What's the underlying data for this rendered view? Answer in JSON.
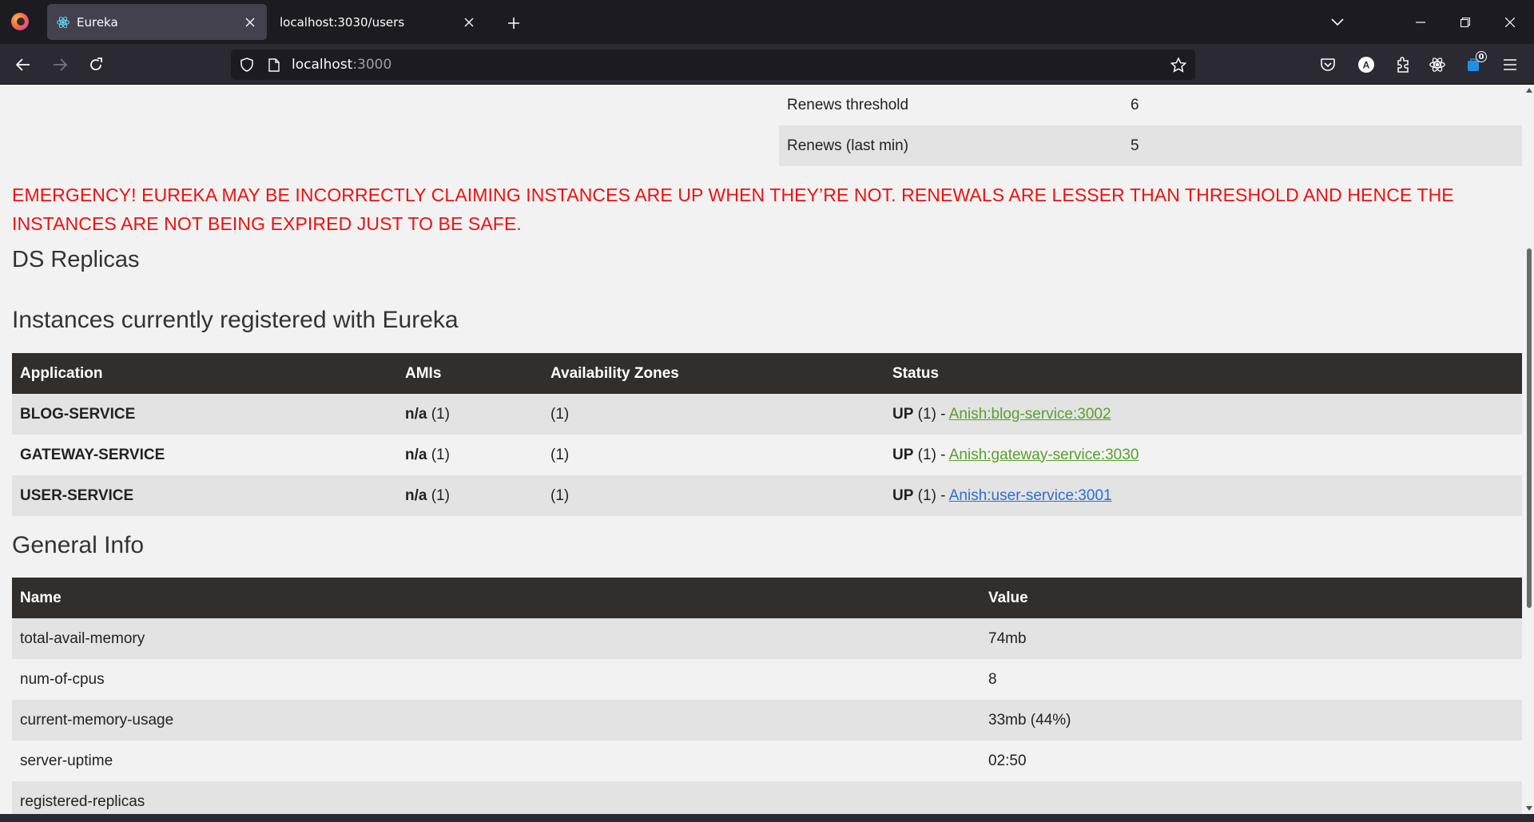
{
  "browser": {
    "tabs": [
      {
        "title": "Eureka",
        "active": true
      },
      {
        "title": "localhost:3030/users",
        "active": false
      }
    ],
    "url_host": "localhost",
    "url_port": ":3000",
    "extension_badge": "0",
    "account_initial": "A"
  },
  "stats": [
    {
      "name": "Renews threshold",
      "value": "6"
    },
    {
      "name": "Renews (last min)",
      "value": "5"
    }
  ],
  "emergency_message": "EMERGENCY! EUREKA MAY BE INCORRECTLY CLAIMING INSTANCES ARE UP WHEN THEY’RE NOT. RENEWALS ARE LESSER THAN THRESHOLD AND HENCE THE INSTANCES ARE NOT BEING EXPIRED JUST TO BE SAFE.",
  "ds_replicas_heading": "DS Replicas",
  "instances": {
    "heading": "Instances currently registered with Eureka",
    "columns": [
      "Application",
      "AMIs",
      "Availability Zones",
      "Status"
    ],
    "rows": [
      {
        "application": "BLOG-SERVICE",
        "ami": "n/a",
        "ami_count": " (1)",
        "zones": "(1)",
        "status": "UP",
        "status_count": " (1) - ",
        "link": "Anish:blog-service:3002"
      },
      {
        "application": "GATEWAY-SERVICE",
        "ami": "n/a",
        "ami_count": " (1)",
        "zones": "(1)",
        "status": "UP",
        "status_count": " (1) - ",
        "link": "Anish:gateway-service:3030"
      },
      {
        "application": "USER-SERVICE",
        "ami": "n/a",
        "ami_count": " (1)",
        "zones": "(1)",
        "status": "UP",
        "status_count": " (1) - ",
        "link": "Anish:user-service:3001"
      }
    ]
  },
  "general_info": {
    "heading": "General Info",
    "columns": [
      "Name",
      "Value"
    ],
    "rows": [
      {
        "name": "total-avail-memory",
        "value": "74mb"
      },
      {
        "name": "num-of-cpus",
        "value": "8"
      },
      {
        "name": "current-memory-usage",
        "value": "33mb (44%)"
      },
      {
        "name": "server-uptime",
        "value": "02:50"
      },
      {
        "name": "registered-replicas",
        "value": ""
      }
    ]
  },
  "colors": {
    "emergency": "#ee1010",
    "table_header": "#312e2b",
    "link": "#5a9e2e",
    "link_visited": "#2a6fd6"
  }
}
